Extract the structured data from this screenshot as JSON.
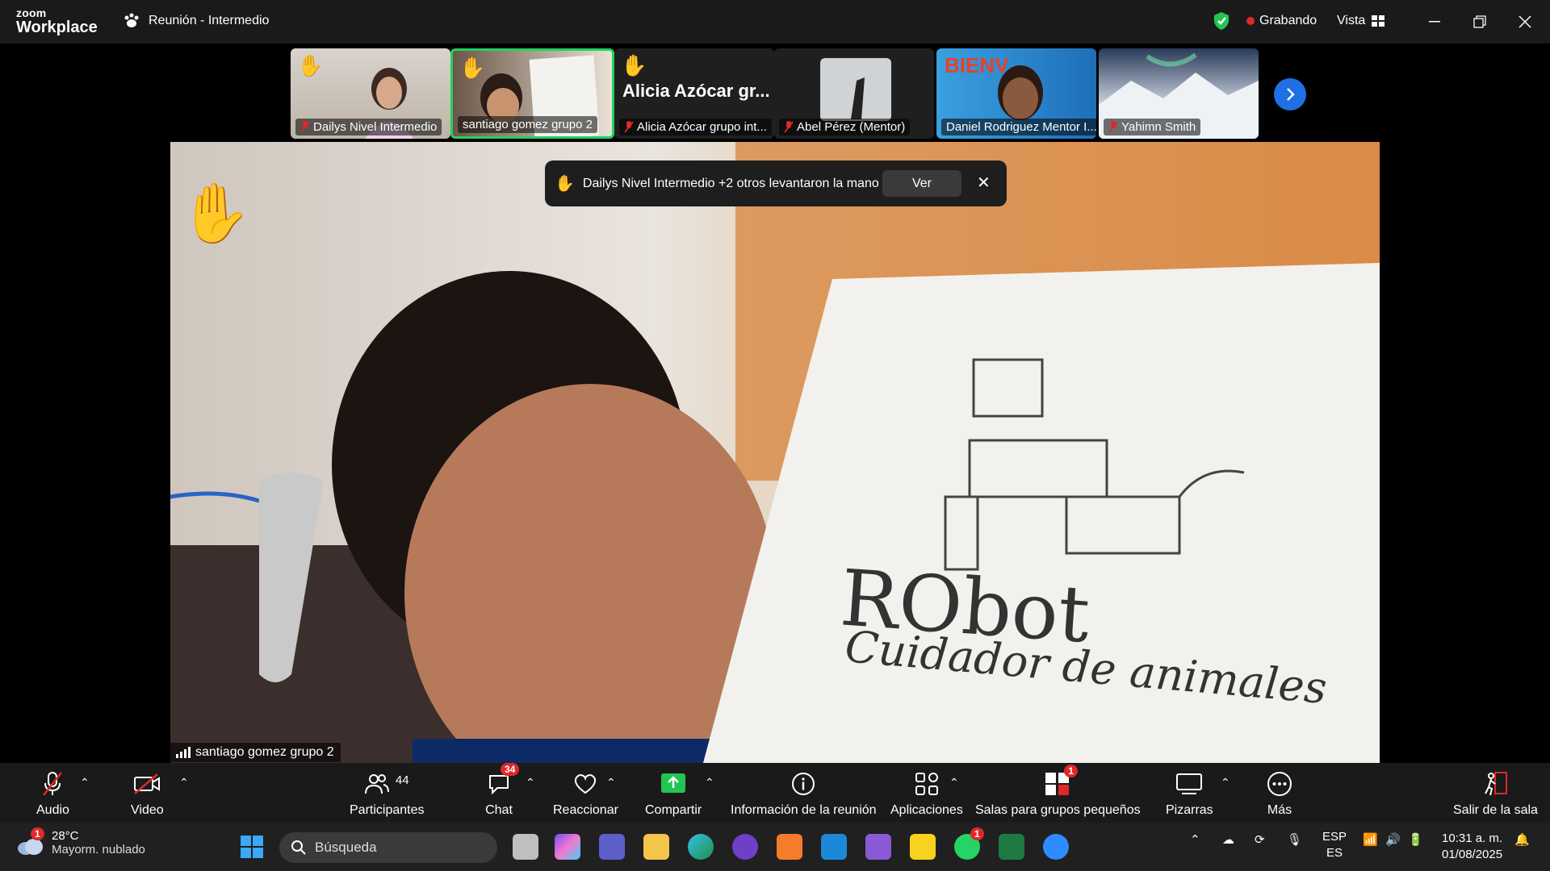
{
  "app": {
    "logo_line1": "zoom",
    "logo_line2": "Workplace",
    "meeting_title": "Reunión - Intermedio",
    "recording_label": "Grabando",
    "view_label": "Vista"
  },
  "thumbnails": [
    {
      "name": "Dailys Nivel Intermedio",
      "hand_raised": true,
      "muted": true
    },
    {
      "name": "santiago gomez grupo 2",
      "hand_raised": true,
      "muted": false,
      "active": true
    },
    {
      "name": "Alicia Azócar grupo int...",
      "big_name": "Alicia  Azócar  gr...",
      "hand_raised": true,
      "muted": true
    },
    {
      "name": "Abel Pérez (Mentor)",
      "hand_raised": false,
      "muted": true
    },
    {
      "name": "Daniel Rodriguez Mentor I...",
      "overlay_text": "BIENV",
      "hand_raised": false,
      "muted": false
    },
    {
      "name": "Yahimn Smith",
      "hand_raised": false,
      "muted": true
    }
  ],
  "notification": {
    "text": "Dailys Nivel Intermedio +2 otros levantaron la mano",
    "view_button": "Ver"
  },
  "main_video": {
    "speaker": "santiago gomez grupo 2",
    "drawing_text_1": "RObot",
    "drawing_text_2": "Cuidador de animales"
  },
  "toolbar": {
    "audio": "Audio",
    "video": "Video",
    "participants": "Participantes",
    "participants_count": "44",
    "chat": "Chat",
    "chat_badge": "34",
    "react": "Reaccionar",
    "share": "Compartir",
    "info": "Información de la reunión",
    "apps": "Aplicaciones",
    "breakout": "Salas para grupos pequeños",
    "breakout_badge": "1",
    "whiteboards": "Pizarras",
    "more": "Más",
    "leave": "Salir de la sala"
  },
  "taskbar": {
    "weather_badge": "1",
    "temperature": "28°C",
    "weather_desc": "Mayorm. nublado",
    "search_placeholder": "Búsqueda",
    "whatsapp_badge": "1",
    "lang_line1": "ESP",
    "lang_line2": "ES",
    "time": "10:31 a. m.",
    "date": "01/08/2025"
  },
  "colors": {
    "accent_green": "#23d160",
    "record_red": "#e02828",
    "share_green": "#23c552",
    "toolbar_bg": "#1a1a1a",
    "taskbar_bg": "#202020",
    "next_blue": "#1f6fe5"
  }
}
